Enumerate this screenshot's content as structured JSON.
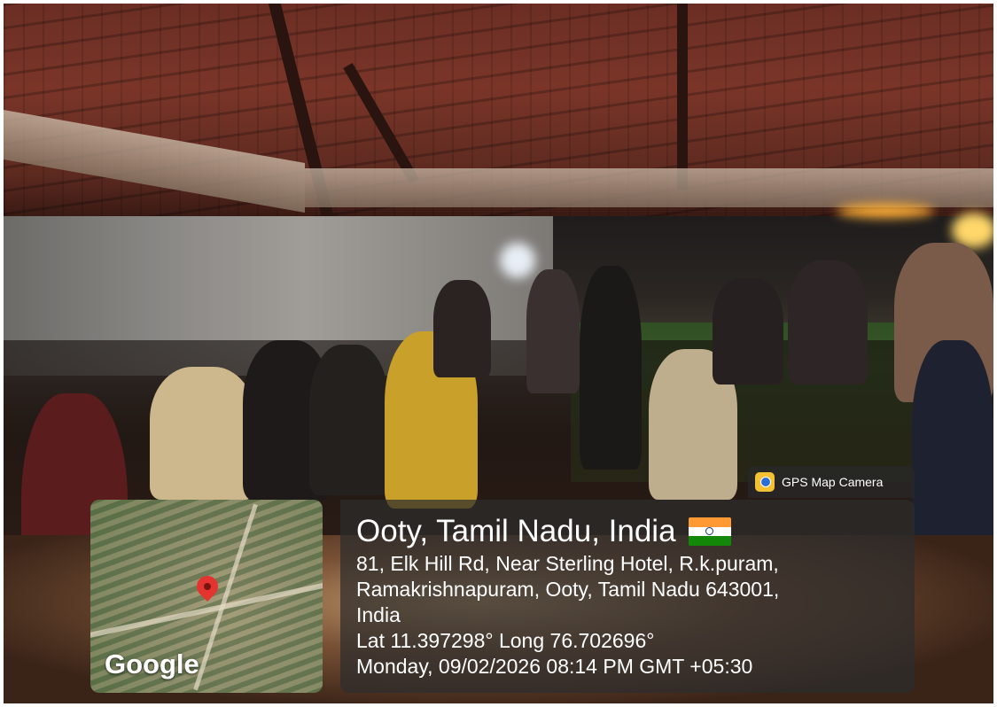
{
  "watermark": {
    "app_name": "GPS Map Camera",
    "app_icon": "gps-map-camera-icon"
  },
  "map": {
    "brand": "Google",
    "pin_icon": "location-pin-icon"
  },
  "location": {
    "title": "Ooty, Tamil Nadu, India",
    "flag": "india-flag-icon",
    "address_line1": "81, Elk Hill Rd, Near Sterling Hotel, R.k.puram,",
    "address_line2": "Ramakrishnapuram, Ooty, Tamil Nadu 643001,",
    "address_line3": "India",
    "coordinates": "Lat 11.397298° Long 76.702696°",
    "datetime": "Monday, 09/02/2026 08:14 PM GMT +05:30"
  },
  "colors": {
    "overlay_bg": "#2d2d2d",
    "pin": "#e4342f",
    "flag_saffron": "#ff9933",
    "flag_green": "#138808"
  }
}
